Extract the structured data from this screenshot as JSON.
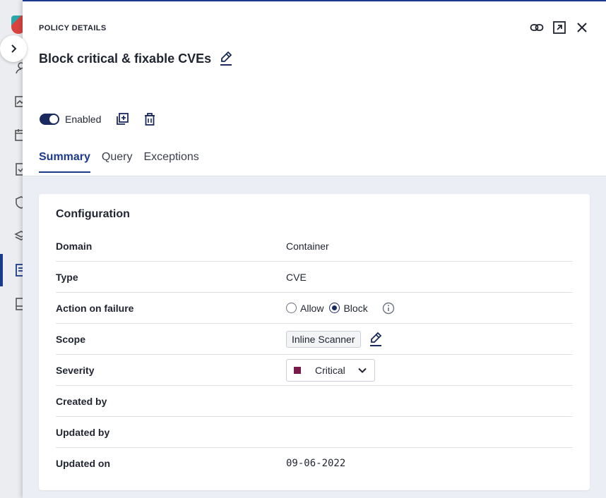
{
  "panel": {
    "eyebrow": "POLICY DETAILS",
    "title": "Block critical & fixable CVEs"
  },
  "status": {
    "enabled": true,
    "label": "Enabled"
  },
  "tabs": [
    {
      "label": "Summary",
      "active": true
    },
    {
      "label": "Query",
      "active": false
    },
    {
      "label": "Exceptions",
      "active": false
    }
  ],
  "configuration": {
    "title": "Configuration",
    "rows": {
      "domain": {
        "label": "Domain",
        "value": "Container"
      },
      "type": {
        "label": "Type",
        "value": "CVE"
      },
      "action": {
        "label": "Action on failure",
        "options": [
          {
            "label": "Allow",
            "checked": false
          },
          {
            "label": "Block",
            "checked": true
          }
        ]
      },
      "scope": {
        "label": "Scope",
        "value": "Inline Scanner"
      },
      "severity": {
        "label": "Severity",
        "value": "Critical",
        "color": "#7a1a4b"
      },
      "created_by": {
        "label": "Created by",
        "value": ""
      },
      "updated_by": {
        "label": "Updated by",
        "value": ""
      },
      "updated_on": {
        "label": "Updated on",
        "value": "09-06-2022"
      }
    }
  },
  "colors": {
    "accent": "#1b3a8c",
    "toggle": "#1b2a5e"
  }
}
